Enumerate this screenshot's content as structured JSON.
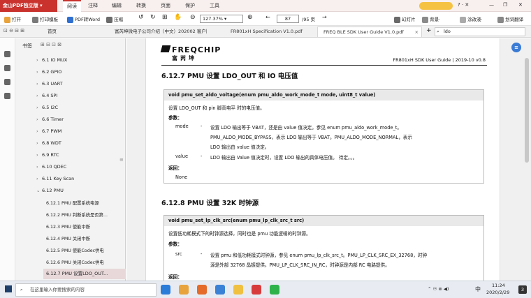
{
  "app": {
    "name": "金山PDF独立版",
    "dropdown": "▾"
  },
  "menu": [
    "阅读",
    "注释",
    "编辑",
    "转换",
    "页面",
    "保护",
    "工具"
  ],
  "window": {
    "tools": "? · ✕",
    "minimize": "—",
    "restore": "❐",
    "close": "✕"
  },
  "toolbar": {
    "open": "打开",
    "template": "打印模板",
    "pdf2word": "PDF转Word",
    "compress": "压缩",
    "zoom": "127.37%",
    "page": "87",
    "total": "/95 页",
    "slideshow": "幻灯片",
    "background": "背景·",
    "annotation": "涂改液·",
    "translate": "划词翻译"
  },
  "tabs": {
    "home": "首页",
    "tab1": "富芮坤微电子公司介绍（中文）202002 客户版.pdf",
    "tab2": "FR801xH Specification V1.0.pdf",
    "tab3": "FREQ BLE SDK User Guide V1.0.pdf",
    "add": "+",
    "search_placeholder": "ldo"
  },
  "sidebar": {
    "title": "书签",
    "items": [
      {
        "label": "6.1 IO MUX"
      },
      {
        "label": "6.2 GPIO"
      },
      {
        "label": "6.3 UART"
      },
      {
        "label": "6.4 SPI"
      },
      {
        "label": "6.5 I2C"
      },
      {
        "label": "6.6 Timer"
      },
      {
        "label": "6.7 PWM"
      },
      {
        "label": "6.8 WDT"
      },
      {
        "label": "6.9 RTC"
      },
      {
        "label": "6.10 QDEC"
      },
      {
        "label": "6.11 Key Scan"
      },
      {
        "label": "6.12 PMU"
      }
    ],
    "subitems": [
      {
        "label": "6.12.1 PMU 配置系统电源"
      },
      {
        "label": "6.12.2 PMU 判断系统是否第..."
      },
      {
        "label": "6.12.3 PMU 使能中断"
      },
      {
        "label": "6.12.4 PMU 关闭中断"
      },
      {
        "label": "6.12.5 PMU 使能Codec供电"
      },
      {
        "label": "6.12.6 PMU 关闭Codec供电"
      },
      {
        "label": "6.12.7 PMU 设置LDO_OUT..."
      }
    ]
  },
  "doc": {
    "logo_en": "FREQCHIP",
    "logo_cn": "富芮坤",
    "header": "FR801xH SDK User Guide | 2019-10 v0.8",
    "s1": {
      "title": "6.12.7 PMU 设置 LDO_OUT 和 IO 电压值",
      "sig": "void pmu_set_aldo_voltage(enum pmu_aldo_work_mode_t mode, uint8_t value)",
      "desc": "设置 LDO_OUT 和 pin 脚高电平 时的电压值。",
      "params": "参数：",
      "p1name": "mode",
      "p1dash": "-",
      "p1l1": "设置 LDO 输出等于 VBAT，还是由 value 值决定。参见 enum pmu_aldo_work_mode_t。",
      "p1l2": "PMU_ALDO_MODE_BYPASS，表示 LDO 输出等于 VBAT。PMU_ALDO_MODE_NORMAL，表示",
      "p1l3": "LDO 输出由 value 值决定。",
      "p2name": "value",
      "p2dash": "-",
      "p2l1": "LDO 输出由 Value 值决定时，设置 LDO 输出的具体电压值。 待定。。。",
      "ret": "返回：",
      "retval": "None"
    },
    "s2": {
      "title": "6.12.8 PMU 设置 32K 时钟源",
      "sig": "void pmu_set_lp_clk_src(enum pmu_lp_clk_src_t src)",
      "desc": "设置低功耗模式下的时钟源选择，同时也是 pmu 功能逻辑的时钟源。",
      "params": "参数：",
      "p1name": "src",
      "p1dash": "-",
      "p1l1": "设置 pmu 和低功耗模式时钟源，参见 enum pmu_lp_clk_src_t。PMU_LP_CLK_SRC_EX_32768，时钟",
      "p1l2": "源是外部 32768 晶振提供。PMU_LP_CLK_SRC_IN_RC，时钟源是内部 RC 电路提供。",
      "ret": "返回："
    }
  },
  "taskbar": {
    "search_placeholder": "在这里输入你要搜索的内容",
    "ime": "中",
    "time": "11:24",
    "date": "2020/2/29",
    "notif": "3"
  },
  "colors": {
    "brand": "#c9322d",
    "selected": "#e8d8da"
  }
}
